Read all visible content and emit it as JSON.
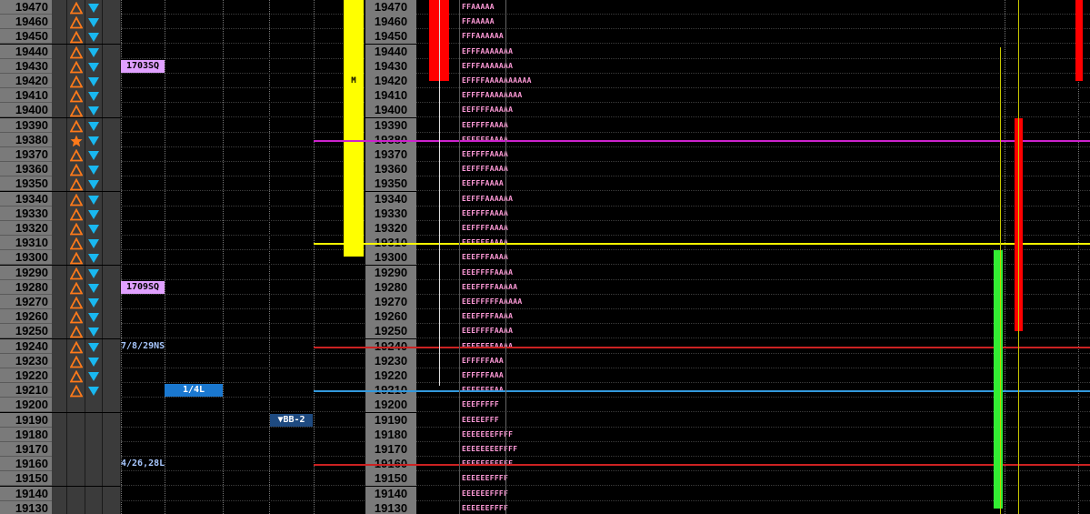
{
  "ladder": {
    "prices": [
      19470,
      19460,
      19450,
      19440,
      19430,
      19420,
      19410,
      19400,
      19390,
      19380,
      19370,
      19360,
      19350,
      19340,
      19330,
      19320,
      19310,
      19300,
      19290,
      19280,
      19270,
      19260,
      19250,
      19240,
      19230,
      19220,
      19210,
      19200,
      19190,
      19180,
      19170,
      19160,
      19150,
      19140,
      19130
    ],
    "tpo_profile": [
      "FFAAAAA",
      "FFAAAAA",
      "FFFAAAAAA",
      "EFFFAAAAAAA",
      "EFFFAAAAAAA",
      "EFFFFAAAAAAAAAA",
      "EFFFFAAAAAAAA",
      "EEFFFFAAAAA",
      "EEFFFFAAAA",
      "EEFFFFAAAA",
      "EEFFFFAAAA",
      "EEFFFFAAAA",
      "EEFFFAAAA",
      "EEFFFAAAAAA",
      "EEFFFFAAAA",
      "EEFFFFAAAA",
      "EEEFFFAAAA",
      "EEEFFFAAAA",
      "EEEFFFFAAAA",
      "EEEFFFFAAAAA",
      "EEEFFFFFAAAAA",
      "EEEFFFFAAAA",
      "EEEFFFFAAAA",
      "EEEFFFFAAAA",
      "EFFFFFAAA",
      "EFFFFFAAA",
      "EEFFFFFAA",
      "EEEFFFFF",
      "EEEEEFFF",
      "EEEEEEEFFFF",
      "EEEEEEEEFFFF",
      "EEEEEEEEFFF",
      "EEEEEEFFFF",
      "EEEEEEFFFF",
      "EEEEEEFFFF"
    ],
    "star_row_index": 9,
    "arrow_rows_end_index": 26,
    "level_badges": [
      {
        "row": 4,
        "label": "1703SQ",
        "color": "#e0a0ff"
      },
      {
        "row": 19,
        "label": "1709SQ",
        "color": "#e0a0ff"
      },
      {
        "row": 23,
        "label": "7/8/29NS",
        "color": "#a8c8ff"
      },
      {
        "row": 31,
        "label": "4/26,28L",
        "color": "#a8c8ff"
      }
    ],
    "level_1_4L": {
      "row": 26,
      "label": "1/4L"
    },
    "bb_badge": {
      "row": 28,
      "label": "▼BB-2"
    },
    "m_label": {
      "row": 5,
      "label": "M"
    },
    "yellow_bar": {
      "from_price": 19470,
      "to_price": 19300
    },
    "horizontal_levels": [
      {
        "price": 19380,
        "color": "#cc22cc"
      },
      {
        "price": 19310,
        "color": "#ffff00"
      },
      {
        "price": 19240,
        "color": "#cc2222"
      },
      {
        "price": 19210,
        "color": "#3399dd"
      },
      {
        "price": 19160,
        "color": "#cc2222"
      }
    ],
    "candles": [
      {
        "name": "candle-red-1",
        "from_price": 19470,
        "to_price": 19420,
        "color": "#ff0000"
      },
      {
        "name": "candle-red-2",
        "from_price": 19390,
        "to_price": 19250,
        "color": "#ff0000"
      },
      {
        "name": "candle-green-1",
        "from_price": 19300,
        "to_price": 19130,
        "color": "#33ee33"
      },
      {
        "name": "candle-red-3",
        "from_price": 19470,
        "to_price": 19420,
        "color": "#ff0000"
      }
    ]
  }
}
